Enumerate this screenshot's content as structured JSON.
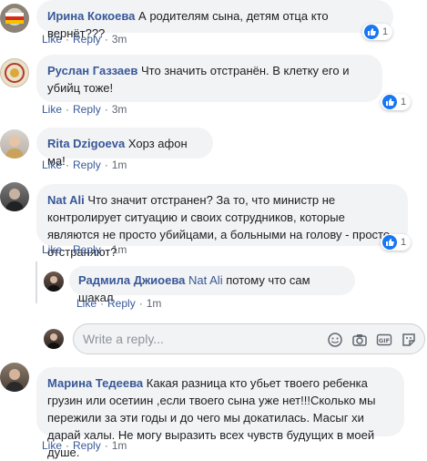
{
  "actions": {
    "like": "Like",
    "reply": "Reply"
  },
  "comments": [
    {
      "author": "Ирина Кокоева",
      "text": "А родителям сына, детям отца кто вернёт???",
      "time": "3m",
      "likes": "1"
    },
    {
      "author": "Руслан Газзаев",
      "text": "Что значить отстранён. В клетку его и убийц тоже!",
      "time": "3m",
      "likes": "1"
    },
    {
      "author": "Rita Dzigoeva",
      "text": "Хорз афон ма!",
      "time": "1m"
    },
    {
      "author": "Nat Ali",
      "text": "Что значит отстранен? За то, что министр не контролирует ситуацию и своих сотрудников, которые являются не просто убийцами, а больными на голову - просто отстраняют?",
      "time": "1m",
      "likes": "1"
    },
    {
      "author": "Марина Тедеева",
      "text": "Какая разница кто убьет твоего ребенка грузин или осетиин ,если твоего сына уже нет!!!Сколько мы пережили за эти годы и до чего мы докатилась. Масыг хи дарай халы. Не могу выразить всех чувств будущих в моей душе.",
      "time": "1m"
    }
  ],
  "reply": {
    "author": "Радмила Джиоева",
    "mention": "Nat Ali",
    "text": "потому что сам шакал",
    "time": "1m"
  },
  "reply_input": {
    "placeholder": "Write a reply..."
  },
  "colors": {
    "link": "#385898",
    "bubble": "#f2f3f5",
    "like_blue": "#1877f2"
  }
}
